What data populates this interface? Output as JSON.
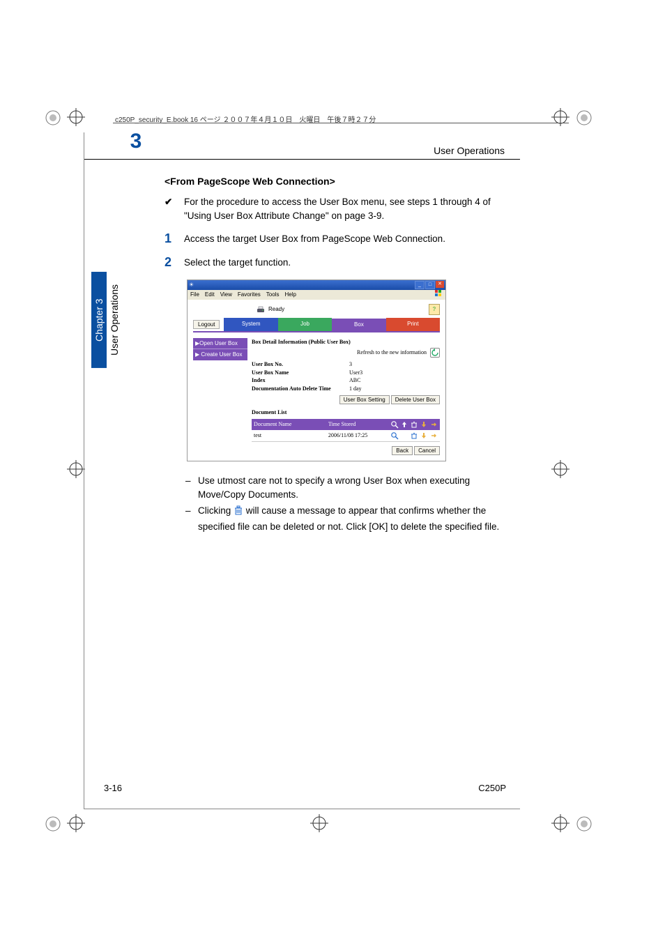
{
  "page_header_line": "c250P_security_E.book  16 ページ  ２００７年４月１０日　火曜日　午後７時２７分",
  "chapter_number": "3",
  "header_right": "User Operations",
  "side_tab_chapter": "Chapter 3",
  "side_tab_title": "User Operations",
  "section_heading": "<From PageScope Web Connection>",
  "check_text": "For the procedure to access the User Box menu, see steps 1 through 4 of \"Using User Box Attribute Change\" on page 3-9.",
  "steps": {
    "s1": {
      "num": "1",
      "text": "Access the target User Box from PageScope Web Connection."
    },
    "s2": {
      "num": "2",
      "text": "Select the target function."
    }
  },
  "screenshot": {
    "menu": {
      "file": "File",
      "edit": "Edit",
      "view": "View",
      "favorites": "Favorites",
      "tools": "Tools",
      "help": "Help"
    },
    "ready_label": "Ready",
    "logout": "Logout",
    "tabs": {
      "system": "System",
      "job": "Job",
      "box": "Box",
      "print": "Print"
    },
    "side": {
      "open": "▶Open User Box",
      "create": "▶ Create User Box"
    },
    "panel_title": "Box Detail Information (Public User Box)",
    "refresh_label": "Refresh to the new information",
    "kv": {
      "k1": "User Box No.",
      "v1": "3",
      "k2": "User Box Name",
      "v2": "User3",
      "k3": "Index",
      "v3": "ABC",
      "k4": "Documentation Auto Delete Time",
      "v4": "1 day"
    },
    "btn_setting": "User Box Setting",
    "btn_delete": "Delete User Box",
    "dlist_title": "Document List",
    "dlist_hdr_name": "Document Name",
    "dlist_hdr_time": "Time Stored",
    "doc_name": "test",
    "doc_time": "2006/11/08 17:25",
    "btn_back": "Back",
    "btn_cancel": "Cancel"
  },
  "notes": {
    "n1": "Use utmost care not to specify a wrong User Box when executing Move/Copy Documents.",
    "n2a": "Clicking ",
    "n2b": " will cause a message to appear that confirms whether the specified file can be deleted or not. Click [OK] to delete the specified file."
  },
  "footer_left": "3-16",
  "footer_right": "C250P"
}
